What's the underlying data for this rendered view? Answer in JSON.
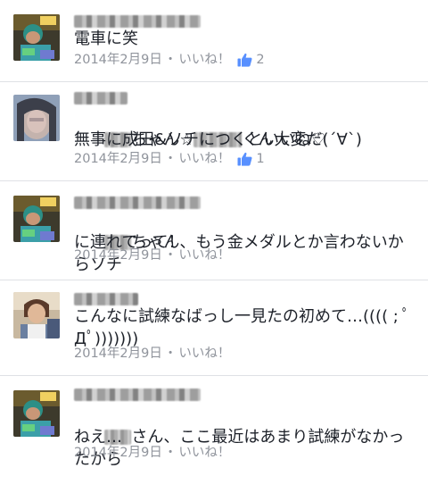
{
  "comments": [
    {
      "avatar": "friend-avatar-1",
      "text": "電車に笑",
      "date": "2014年2月9日",
      "like_label": "いいね！",
      "like_count": "2"
    },
    {
      "avatar": "friend-avatar-2",
      "text_line1_mid": "ちゃん☆",
      "text_line1_end": "くん大変だ(´∀`)",
      "text_line2": "無事に成田&ソチにつくといいね♡",
      "date": "2014年2月9日",
      "like_label": "いいね！",
      "like_count": "1"
    },
    {
      "avatar": "friend-avatar-1",
      "text_line1": "ちゃん、もう金メダルとか言わないからソチ",
      "text_line2": "に連れてって！",
      "date": "2014年2月9日",
      "like_label": "いいね！"
    },
    {
      "avatar": "friend-avatar-3",
      "text": "こんなに試練なばっし一見たの初めて…(((( ; ﾟ\nДﾟ)))))))",
      "date": "2014年2月9日",
      "like_label": "いいね！"
    },
    {
      "avatar": "friend-avatar-1",
      "text_line1": "さん、ここ最近はあまり試練がなかったから",
      "text_line2": "ねえ…",
      "date": "2014年2月9日",
      "like_label": "いいね！"
    }
  ],
  "separator": "・",
  "icons": {
    "like": "thumbs-up-icon",
    "like_color": "#5890ff"
  }
}
